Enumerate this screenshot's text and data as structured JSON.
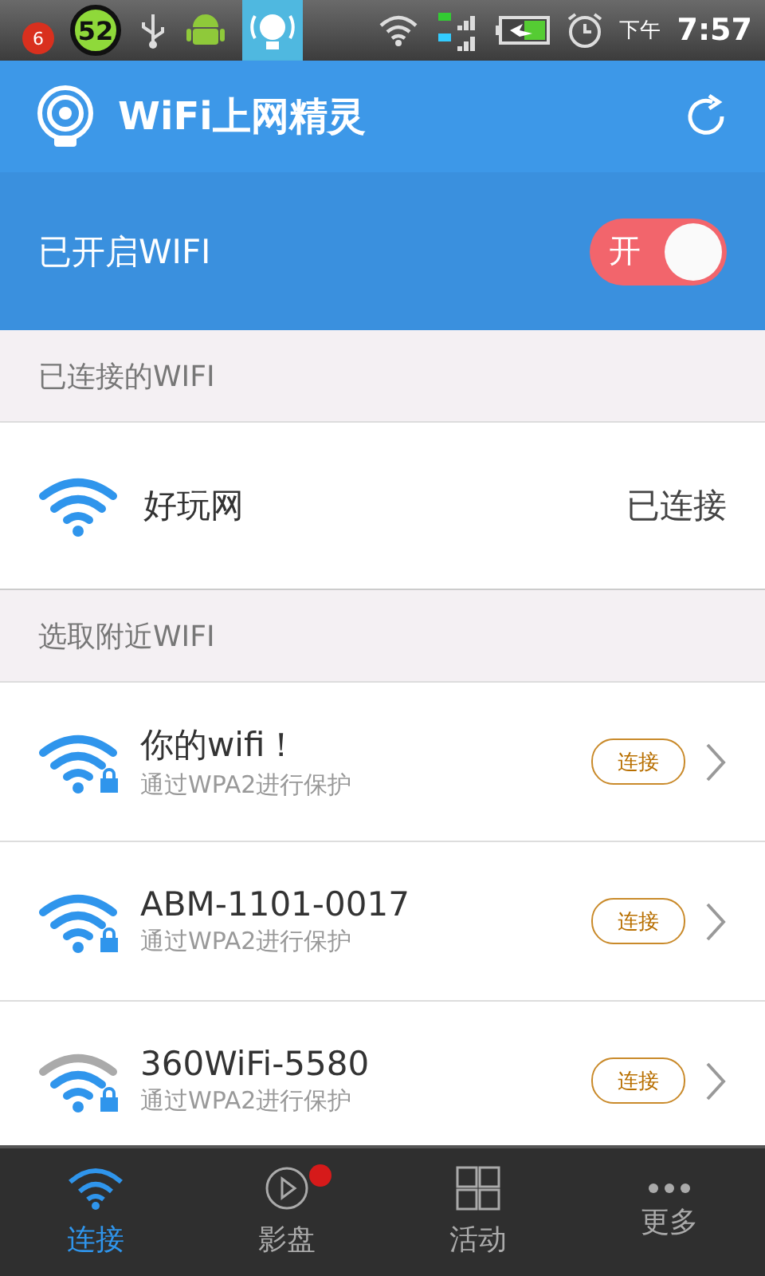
{
  "status_bar": {
    "notification_count": "6",
    "gauge": "52",
    "period": "下午",
    "time": "7:57"
  },
  "app_bar": {
    "title": "WiFi上网精灵"
  },
  "wifi_switch": {
    "label": "已开启WIFI",
    "on": true,
    "switch_text": "开"
  },
  "connected_section": {
    "title": "已连接的WIFI",
    "network": {
      "name": "好玩网",
      "status": "已连接",
      "weak_signal": false
    }
  },
  "nearby_section": {
    "title": "选取附近WIFI",
    "networks": [
      {
        "name": "你的wifi！",
        "security": "通过WPA2进行保护",
        "action": "连接",
        "weak_signal": false
      },
      {
        "name": "ABM-1101-0017",
        "security": "通过WPA2进行保护",
        "action": "连接",
        "weak_signal": false
      },
      {
        "name": "360WiFi-5580",
        "security": "通过WPA2进行保护",
        "action": "连接",
        "weak_signal": true
      }
    ]
  },
  "bottom_nav": [
    {
      "label": "连接",
      "kind": "wifi",
      "selected": true,
      "dot": false
    },
    {
      "label": "影盘",
      "kind": "play",
      "selected": false,
      "dot": true
    },
    {
      "label": "活动",
      "kind": "grid",
      "selected": false,
      "dot": false
    },
    {
      "label": "更多",
      "kind": "more",
      "selected": false,
      "dot": false
    }
  ]
}
